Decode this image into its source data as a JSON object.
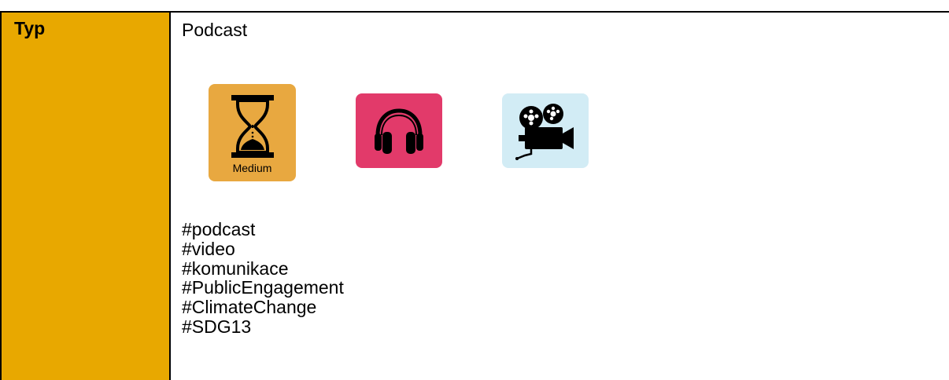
{
  "row": {
    "label": "Typ",
    "value": "Podcast"
  },
  "tiles": {
    "medium": {
      "label": "Medium",
      "icon": "hourglass-icon",
      "color": "#E8A840"
    },
    "audio": {
      "icon": "headphones-icon",
      "color": "#E23A6A"
    },
    "video": {
      "icon": "film-camera-icon",
      "color": "#D2ECF5"
    }
  },
  "colors": {
    "label_cell": "#E8A800"
  },
  "hashtags": [
    "#podcast",
    "#video",
    "#komunikace",
    "#PublicEngagement",
    "#ClimateChange",
    "#SDG13"
  ]
}
